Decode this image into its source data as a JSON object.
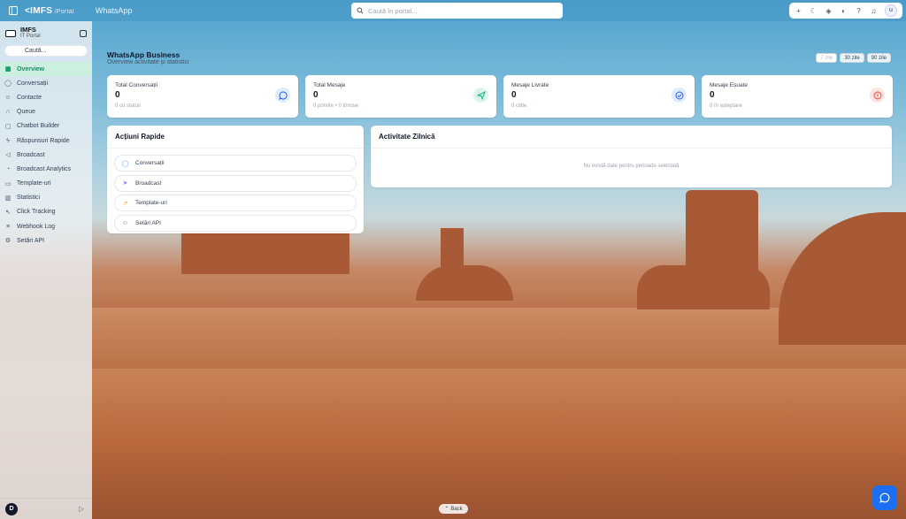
{
  "topbar": {
    "logo": "IMFS",
    "logo_sub": "Portal",
    "page": "WhatsApp",
    "search_placeholder": "Caută în portal..."
  },
  "sidebar": {
    "workspace_name": "IMFS",
    "workspace_sub": "IT Portal",
    "search_label": "Caută...",
    "items": [
      {
        "label": "Overview",
        "icon": "grid-icon",
        "active": true
      },
      {
        "label": "Conversații",
        "icon": "chat-icon"
      },
      {
        "label": "Contacte",
        "icon": "users-icon"
      },
      {
        "label": "Queue",
        "icon": "headset-icon"
      },
      {
        "label": "Chatbot Builder",
        "icon": "bot-icon"
      },
      {
        "label": "Răspunsuri Rapide",
        "icon": "bolt-icon"
      },
      {
        "label": "Broadcast",
        "icon": "megaphone-icon"
      },
      {
        "label": "Broadcast Analytics",
        "icon": "chart-icon"
      },
      {
        "label": "Template-uri",
        "icon": "file-icon"
      },
      {
        "label": "Statistici",
        "icon": "bar-chart-icon"
      },
      {
        "label": "Click Tracking",
        "icon": "cursor-icon"
      },
      {
        "label": "Webhook Log",
        "icon": "log-icon"
      },
      {
        "label": "Setări API",
        "icon": "settings-icon"
      }
    ],
    "user_initial": "D"
  },
  "header": {
    "title": "WhatsApp Business",
    "subtitle": "Overview activitate și statistici",
    "ranges": [
      "7 zile",
      "30 zile",
      "90 zile"
    ]
  },
  "stats": [
    {
      "label": "Total Conversații",
      "value": "0",
      "hint": "0 cu status",
      "color": "#2563eb"
    },
    {
      "label": "Total Mesaje",
      "value": "0",
      "hint": "0 primite • 0 trimise",
      "color": "#10b981"
    },
    {
      "label": "Mesaje Livrate",
      "value": "0",
      "hint": "0 citite",
      "color": "#2563eb"
    },
    {
      "label": "Mesaje Eșuate",
      "value": "0",
      "hint": "0 în așteptare",
      "color": "#ef4444"
    }
  ],
  "quick_actions": {
    "title": "Acțiuni Rapide",
    "items": [
      {
        "label": "Conversații",
        "icon": "chat-icon"
      },
      {
        "label": "Broadcast",
        "icon": "send-icon"
      },
      {
        "label": "Template-uri",
        "icon": "trend-icon"
      },
      {
        "label": "Setări API",
        "icon": "users-icon"
      }
    ]
  },
  "daily_activity": {
    "title": "Activitate Zilnică",
    "empty": "Nu există date pentru perioada selectată"
  },
  "back_label": "Back"
}
